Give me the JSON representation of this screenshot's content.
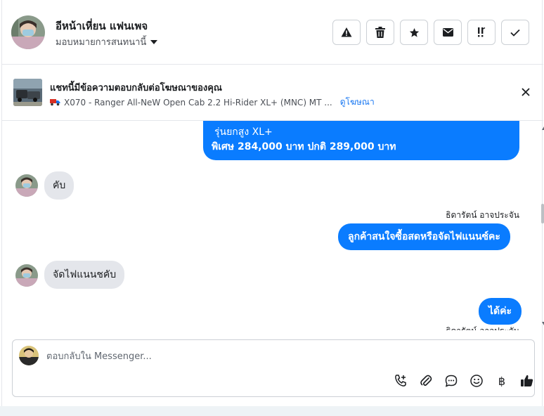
{
  "header": {
    "contact_name": "อีหน้าเหี่ยน แฟนเพจ",
    "assign_label": "มอบหมายการสนทนานี้",
    "actions": [
      {
        "icon": "warning-icon"
      },
      {
        "icon": "trash-icon"
      },
      {
        "icon": "star-icon"
      },
      {
        "icon": "envelope-icon"
      },
      {
        "icon": "follow-up-icon"
      },
      {
        "icon": "check-icon"
      }
    ]
  },
  "ad_banner": {
    "title": "แชทนี้มีข้อความตอบกลับต่อโฆษณาของคุณ",
    "subtitle": "X070 - Ranger All-NeW Open Cab 2.2 Hi-Rider XL+ (MNC) MT ...",
    "link": "ดูโฆษณา"
  },
  "messages": {
    "top_out_line1": "รุ่นยกสูง XL+",
    "top_out_line2": "พิเศษ 284,000 บาท  ปกติ 289,000 บาท",
    "in_1": "คับ",
    "sender_1": "ธิดารัตน์ อาจประจัน",
    "out_2": "ลูกค้าสนใจซื้อสดหรือจัดไฟแนนซ์คะ",
    "in_2": "จัดไฟแนนชคับ",
    "out_3": "ได้ค่ะ",
    "sender_2": "ธิดารัตน์ อาจประจัน"
  },
  "composer": {
    "placeholder": "ตอบกลับใน Messenger...",
    "baht_symbol": "฿"
  },
  "colors": {
    "outgoing": "#0a7cff",
    "incoming": "#e4e6eb",
    "link": "#1877f2"
  }
}
